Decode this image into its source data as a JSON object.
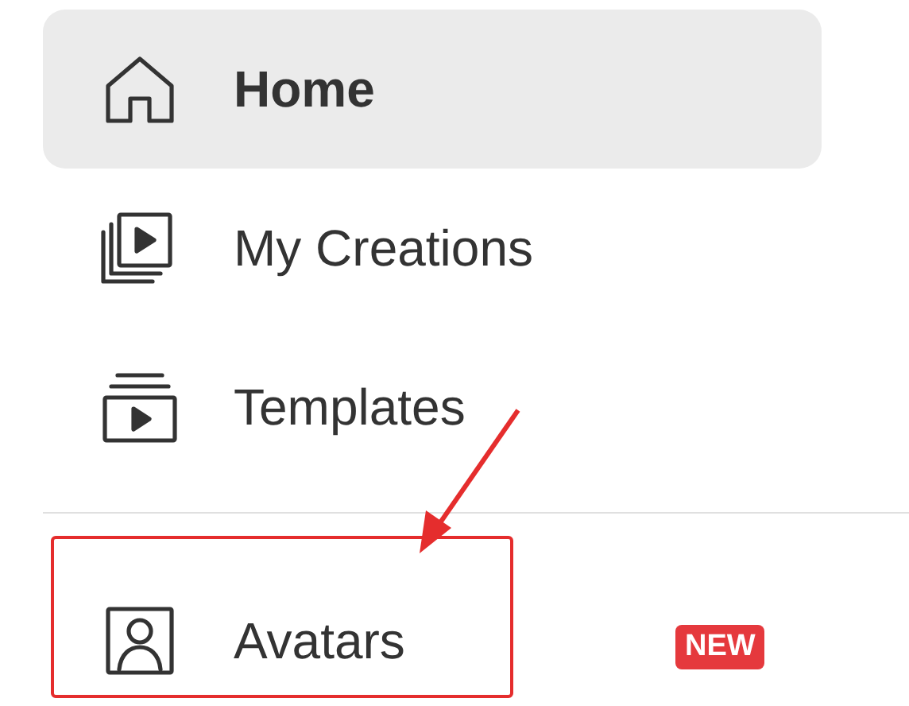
{
  "nav_items": [
    {
      "label": "Home",
      "kind": "home",
      "selected": true,
      "highlighted": false
    },
    {
      "label": "My Creations",
      "kind": "creations",
      "selected": false,
      "highlighted": false
    },
    {
      "label": "Templates",
      "kind": "templates",
      "selected": false,
      "highlighted": false
    }
  ],
  "nav_items_2": [
    {
      "label": "Avatars",
      "kind": "avatars",
      "selected": false,
      "highlighted": true,
      "badge": "NEW"
    }
  ]
}
